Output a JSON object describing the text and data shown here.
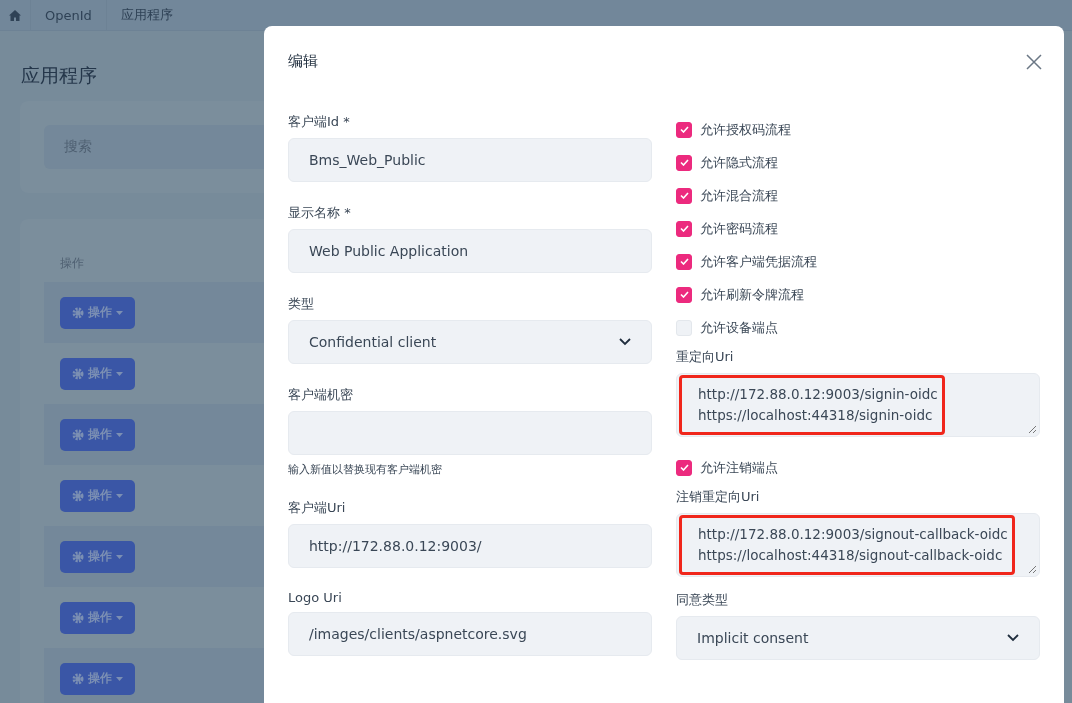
{
  "breadcrumb": [
    "OpenId",
    "应用程序"
  ],
  "page_title": "应用程序",
  "search": {
    "placeholder": "搜索"
  },
  "table": {
    "column_header": "操作",
    "rows": [
      {
        "action": "操作"
      },
      {
        "action": "操作"
      },
      {
        "action": "操作"
      },
      {
        "action": "操作"
      },
      {
        "action": "操作"
      },
      {
        "action": "操作"
      },
      {
        "action": "操作"
      }
    ]
  },
  "modal": {
    "title": "编辑",
    "left_fields": [
      {
        "kind": "input",
        "label": "客户端Id *",
        "value": "Bms_Web_Public"
      },
      {
        "kind": "input",
        "label": "显示名称 *",
        "value": "Web Public Application"
      },
      {
        "kind": "select",
        "label": "类型",
        "value": "Confidential client"
      },
      {
        "kind": "input",
        "label": "客户端机密",
        "help": "输入新值以替换现有客户端机密"
      },
      {
        "kind": "input",
        "label": "客户端Uri",
        "value": "http://172.88.0.12:9003/"
      },
      {
        "kind": "input",
        "label": "Logo Uri",
        "value": "/images/clients/aspnetcore.svg"
      }
    ],
    "right_fields": [
      {
        "kind": "checkbox",
        "label": "允许授权码流程",
        "checked": true
      },
      {
        "kind": "checkbox",
        "label": "允许隐式流程",
        "checked": true
      },
      {
        "kind": "checkbox",
        "label": "允许混合流程",
        "checked": true
      },
      {
        "kind": "checkbox",
        "label": "允许密码流程",
        "checked": true
      },
      {
        "kind": "checkbox",
        "label": "允许客户端凭据流程",
        "checked": true
      },
      {
        "kind": "checkbox",
        "label": "允许刷新令牌流程",
        "checked": true
      },
      {
        "kind": "checkbox",
        "label": "允许设备端点",
        "checked": false
      },
      {
        "kind": "textarea",
        "label": "重定向Uri",
        "lines": [
          "http://172.88.0.12:9003/signin-oidc",
          "https://localhost:44318/signin-oidc"
        ],
        "highlighted": true
      },
      {
        "kind": "checkbox",
        "label": "允许注销端点",
        "checked": true
      },
      {
        "kind": "textarea",
        "label": "注销重定向Uri",
        "lines": [
          "http://172.88.0.12:9003/signout-callback-oidc",
          "https://localhost:44318/signout-callback-oidc"
        ],
        "highlighted": true
      },
      {
        "kind": "select",
        "label": "同意类型",
        "value": "Implicit consent"
      }
    ]
  }
}
